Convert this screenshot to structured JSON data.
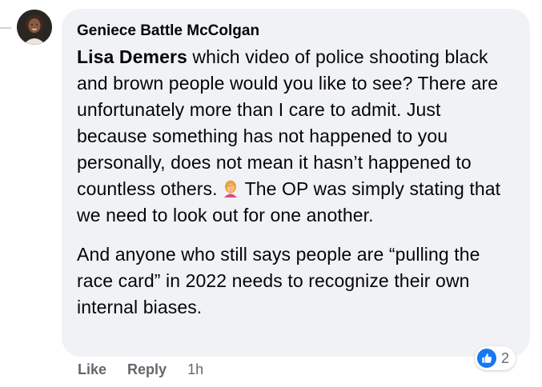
{
  "comment": {
    "author": "Geniece Battle McColgan",
    "mention": "Lisa Demers",
    "paragraph1_text": " which video of police shooting black and brown people would you like to see? There are unfortunately more than I care to admit. Just because something has not happened to you personally, does not mean it hasn’t happened to countless others.",
    "paragraph1_after_emoji": "The OP was simply stating that we need to look out for one another.",
    "paragraph2": "And anyone who still says people are “pulling the race card” in 2022 needs to recognize their own internal biases."
  },
  "reactions": {
    "icon": "like-icon",
    "count": "2"
  },
  "actions": {
    "like_label": "Like",
    "reply_label": "Reply",
    "timestamp": "1h"
  },
  "colors": {
    "bubble_bg": "#f0f2f5",
    "text": "#050505",
    "meta": "#65676b",
    "like_blue": "#1877f2"
  }
}
